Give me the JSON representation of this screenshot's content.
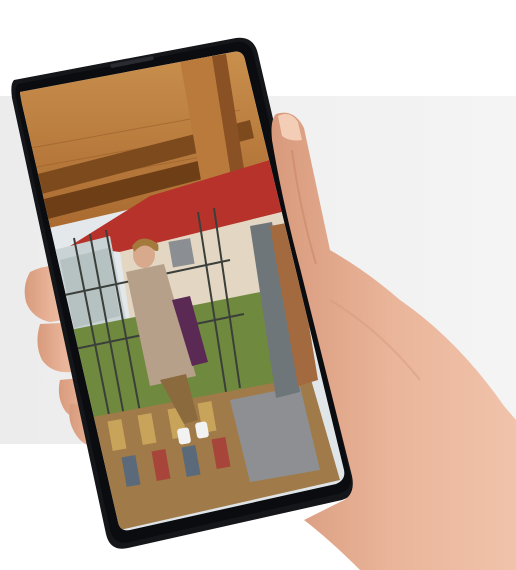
{
  "image": {
    "subject": "hand-holding-smartphone",
    "screen_content": "photo-of-person-in-coat-on-porch"
  },
  "colors": {
    "background_panel": "#efefef",
    "phone_frame": "#15161a",
    "skin": "#e8b195",
    "wood_ceiling": "#c08040",
    "roof_tiles": "#b8322c",
    "coat": "#b6a08a",
    "paving": "#a07a48"
  }
}
